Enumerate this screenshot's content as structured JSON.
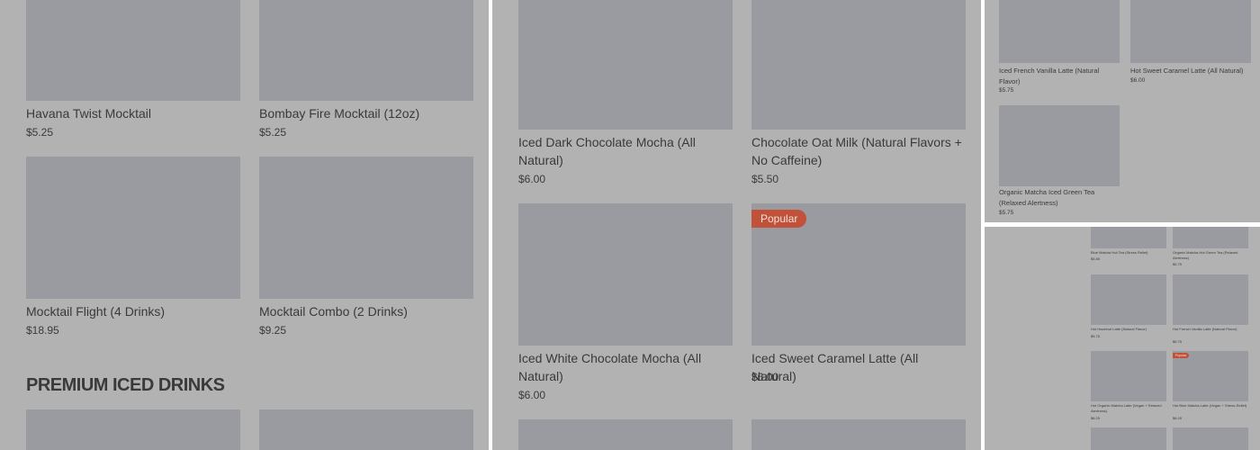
{
  "panel1": {
    "items": [
      {
        "name": "Havana Twist Mocktail",
        "price": "$5.25"
      },
      {
        "name": "Bombay Fire Mocktail (12oz)",
        "price": "$5.25"
      },
      {
        "name": "Mocktail Flight (4 Drinks)",
        "price": "$18.95"
      },
      {
        "name": "Mocktail Combo (2 Drinks)",
        "price": "$9.25"
      }
    ],
    "section_title": "PREMIUM ICED DRINKS"
  },
  "panel2": {
    "items": [
      {
        "name": "Iced Dark Chocolate Mocha (All Natural)",
        "price": "$6.00"
      },
      {
        "name": "Chocolate Oat Milk (Natural Flavors + No Caffeine)",
        "price": "$5.50"
      },
      {
        "name": "Iced White Chocolate Mocha (All Natural)",
        "price": "$6.00"
      },
      {
        "name": "Iced Sweet Caramel Latte (All Natural)",
        "price": "$6.00",
        "badge": "Popular"
      }
    ]
  },
  "panel3": {
    "items": [
      {
        "name": "Iced French Vanilla Latte (Natural Flavor)",
        "price": "$5.75"
      },
      {
        "name": "Hot Sweet Caramel Latte (All Natural)",
        "price": "$6.00"
      },
      {
        "name": "Organic Matcha Iced Green Tea (Relaxed Alertness)",
        "price": "$5.75"
      }
    ]
  },
  "panel4": {
    "items": [
      {
        "name": "Blue Matcha Hot Tea (Stress Relief)",
        "price": "$5.85"
      },
      {
        "name": "Organic Matcha Hot Green Tea (Relaxed Alertness)",
        "price": "$5.75"
      },
      {
        "name": "Hot Hazelnut Latte (Natural Flavor)",
        "price": "$5.75"
      },
      {
        "name": "Hot French Vanilla Latte (Natural Flavor)",
        "price": "$5.75"
      },
      {
        "name": "Hot Organic Matcha Latte (Vegan + Relaxed Alertness)",
        "price": "$6.25"
      },
      {
        "name": "Hot Blue Matcha Latte (Vegan + Stress-Relief)",
        "price": "$6.25",
        "badge": "Popular"
      }
    ]
  },
  "colors": {
    "overlay": "#b2b2b2",
    "thumbnail": "#9a9ba1",
    "badge": "#c2513a",
    "text": "#3a3a3a"
  }
}
